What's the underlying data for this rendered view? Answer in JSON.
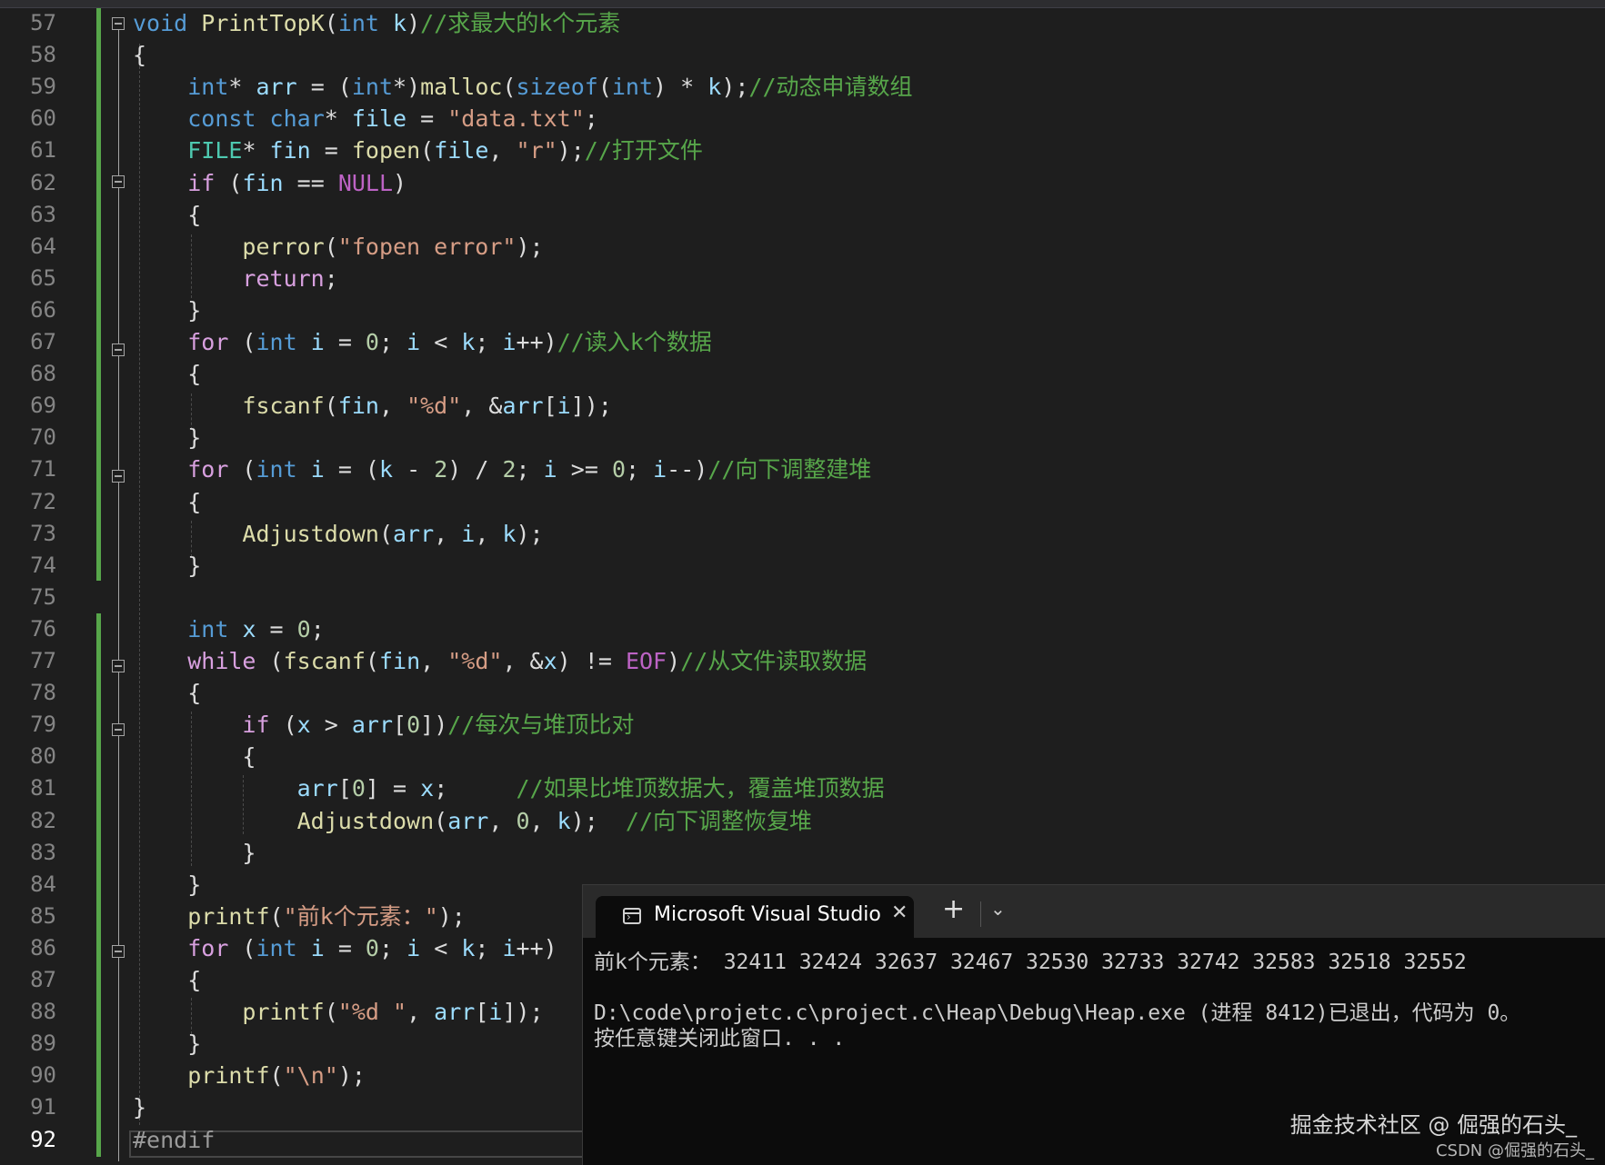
{
  "editor": {
    "current_line": "92",
    "lines": [
      {
        "n": "57",
        "t": [
          [
            "void",
            "kw"
          ],
          [
            " ",
            ""
          ],
          [
            "PrintTopK",
            "fn"
          ],
          [
            "(",
            ""
          ],
          [
            "int",
            "kw"
          ],
          [
            " ",
            ""
          ],
          [
            "k",
            "var"
          ],
          [
            ")",
            ""
          ],
          [
            "//求最大的k个元素",
            "cmt"
          ]
        ]
      },
      {
        "n": "58",
        "t": [
          [
            "{",
            ""
          ]
        ]
      },
      {
        "n": "59",
        "t": [
          [
            "    ",
            ""
          ],
          [
            "int",
            "kw"
          ],
          [
            "* ",
            ""
          ],
          [
            "arr",
            "var"
          ],
          [
            " = (",
            ""
          ],
          [
            "int",
            "kw"
          ],
          [
            "*)",
            ""
          ],
          [
            "malloc",
            "fn"
          ],
          [
            "(",
            ""
          ],
          [
            "sizeof",
            "kw"
          ],
          [
            "(",
            ""
          ],
          [
            "int",
            "kw"
          ],
          [
            ") * ",
            ""
          ],
          [
            "k",
            "var"
          ],
          [
            ");",
            ""
          ],
          [
            "//动态申请数组",
            "cmt"
          ]
        ]
      },
      {
        "n": "60",
        "t": [
          [
            "    ",
            ""
          ],
          [
            "const",
            "kw"
          ],
          [
            " ",
            ""
          ],
          [
            "char",
            "kw"
          ],
          [
            "* ",
            ""
          ],
          [
            "file",
            "var"
          ],
          [
            " = ",
            ""
          ],
          [
            "\"data.txt\"",
            "str"
          ],
          [
            ";",
            ""
          ]
        ]
      },
      {
        "n": "61",
        "t": [
          [
            "    ",
            ""
          ],
          [
            "FILE",
            "ty"
          ],
          [
            "* ",
            ""
          ],
          [
            "fin",
            "var"
          ],
          [
            " = ",
            ""
          ],
          [
            "fopen",
            "fn"
          ],
          [
            "(",
            ""
          ],
          [
            "file",
            "var"
          ],
          [
            ", ",
            ""
          ],
          [
            "\"r\"",
            "str"
          ],
          [
            ");",
            ""
          ],
          [
            "//打开文件",
            "cmt"
          ]
        ]
      },
      {
        "n": "62",
        "t": [
          [
            "    ",
            ""
          ],
          [
            "if",
            "ctl"
          ],
          [
            " (",
            ""
          ],
          [
            "fin",
            "var"
          ],
          [
            " == ",
            ""
          ],
          [
            "NULL",
            "mac"
          ],
          [
            ")",
            ""
          ]
        ]
      },
      {
        "n": "63",
        "t": [
          [
            "    {",
            ""
          ]
        ]
      },
      {
        "n": "64",
        "t": [
          [
            "        ",
            ""
          ],
          [
            "perror",
            "fn"
          ],
          [
            "(",
            ""
          ],
          [
            "\"fopen error\"",
            "str"
          ],
          [
            ");",
            ""
          ]
        ]
      },
      {
        "n": "65",
        "t": [
          [
            "        ",
            ""
          ],
          [
            "return",
            "ctl"
          ],
          [
            ";",
            ""
          ]
        ]
      },
      {
        "n": "66",
        "t": [
          [
            "    }",
            ""
          ]
        ]
      },
      {
        "n": "67",
        "t": [
          [
            "    ",
            ""
          ],
          [
            "for",
            "ctl"
          ],
          [
            " (",
            ""
          ],
          [
            "int",
            "kw"
          ],
          [
            " ",
            ""
          ],
          [
            "i",
            "var"
          ],
          [
            " = ",
            ""
          ],
          [
            "0",
            "num"
          ],
          [
            "; ",
            ""
          ],
          [
            "i",
            "var"
          ],
          [
            " < ",
            ""
          ],
          [
            "k",
            "var"
          ],
          [
            "; ",
            ""
          ],
          [
            "i",
            "var"
          ],
          [
            "++)",
            ""
          ],
          [
            "//读入k个数据",
            "cmt"
          ]
        ]
      },
      {
        "n": "68",
        "t": [
          [
            "    {",
            ""
          ]
        ]
      },
      {
        "n": "69",
        "t": [
          [
            "        ",
            ""
          ],
          [
            "fscanf",
            "fn"
          ],
          [
            "(",
            ""
          ],
          [
            "fin",
            "var"
          ],
          [
            ", ",
            ""
          ],
          [
            "\"%d\"",
            "str"
          ],
          [
            ", &",
            ""
          ],
          [
            "arr",
            "var"
          ],
          [
            "[",
            ""
          ],
          [
            "i",
            "var"
          ],
          [
            "]);",
            ""
          ]
        ]
      },
      {
        "n": "70",
        "t": [
          [
            "    }",
            ""
          ]
        ]
      },
      {
        "n": "71",
        "t": [
          [
            "    ",
            ""
          ],
          [
            "for",
            "ctl"
          ],
          [
            " (",
            ""
          ],
          [
            "int",
            "kw"
          ],
          [
            " ",
            ""
          ],
          [
            "i",
            "var"
          ],
          [
            " = (",
            ""
          ],
          [
            "k",
            "var"
          ],
          [
            " - ",
            ""
          ],
          [
            "2",
            "num"
          ],
          [
            ") / ",
            ""
          ],
          [
            "2",
            "num"
          ],
          [
            "; ",
            ""
          ],
          [
            "i",
            "var"
          ],
          [
            " >= ",
            ""
          ],
          [
            "0",
            "num"
          ],
          [
            "; ",
            ""
          ],
          [
            "i",
            "var"
          ],
          [
            "--)",
            ""
          ],
          [
            "//向下调整建堆",
            "cmt"
          ]
        ]
      },
      {
        "n": "72",
        "t": [
          [
            "    {",
            ""
          ]
        ]
      },
      {
        "n": "73",
        "t": [
          [
            "        ",
            ""
          ],
          [
            "Adjustdown",
            "fn"
          ],
          [
            "(",
            ""
          ],
          [
            "arr",
            "var"
          ],
          [
            ", ",
            ""
          ],
          [
            "i",
            "var"
          ],
          [
            ", ",
            ""
          ],
          [
            "k",
            "var"
          ],
          [
            ");",
            ""
          ]
        ]
      },
      {
        "n": "74",
        "t": [
          [
            "    }",
            ""
          ]
        ]
      },
      {
        "n": "75",
        "t": []
      },
      {
        "n": "76",
        "t": [
          [
            "    ",
            ""
          ],
          [
            "int",
            "kw"
          ],
          [
            " ",
            ""
          ],
          [
            "x",
            "var"
          ],
          [
            " = ",
            ""
          ],
          [
            "0",
            "num"
          ],
          [
            ";",
            ""
          ]
        ]
      },
      {
        "n": "77",
        "t": [
          [
            "    ",
            ""
          ],
          [
            "while",
            "ctl"
          ],
          [
            " (",
            ""
          ],
          [
            "fscanf",
            "fn"
          ],
          [
            "(",
            ""
          ],
          [
            "fin",
            "var"
          ],
          [
            ", ",
            ""
          ],
          [
            "\"%d\"",
            "str"
          ],
          [
            ", &",
            ""
          ],
          [
            "x",
            "var"
          ],
          [
            ") != ",
            ""
          ],
          [
            "EOF",
            "mac"
          ],
          [
            ")",
            ""
          ],
          [
            "//从文件读取数据",
            "cmt"
          ]
        ]
      },
      {
        "n": "78",
        "t": [
          [
            "    {",
            ""
          ]
        ]
      },
      {
        "n": "79",
        "t": [
          [
            "        ",
            ""
          ],
          [
            "if",
            "ctl"
          ],
          [
            " (",
            ""
          ],
          [
            "x",
            "var"
          ],
          [
            " > ",
            ""
          ],
          [
            "arr",
            "var"
          ],
          [
            "[",
            ""
          ],
          [
            "0",
            "num"
          ],
          [
            "])",
            ""
          ],
          [
            "//每次与堆顶比对",
            "cmt"
          ]
        ]
      },
      {
        "n": "80",
        "t": [
          [
            "        {",
            ""
          ]
        ]
      },
      {
        "n": "81",
        "t": [
          [
            "            ",
            ""
          ],
          [
            "arr",
            "var"
          ],
          [
            "[",
            ""
          ],
          [
            "0",
            "num"
          ],
          [
            "] = ",
            ""
          ],
          [
            "x",
            "var"
          ],
          [
            ";     ",
            ""
          ],
          [
            "//如果比堆顶数据大，覆盖堆顶数据",
            "cmt"
          ]
        ]
      },
      {
        "n": "82",
        "t": [
          [
            "            ",
            ""
          ],
          [
            "Adjustdown",
            "fn"
          ],
          [
            "(",
            ""
          ],
          [
            "arr",
            "var"
          ],
          [
            ", ",
            ""
          ],
          [
            "0",
            "num"
          ],
          [
            ", ",
            ""
          ],
          [
            "k",
            "var"
          ],
          [
            ");  ",
            ""
          ],
          [
            "//向下调整恢复堆",
            "cmt"
          ]
        ]
      },
      {
        "n": "83",
        "t": [
          [
            "        }",
            ""
          ]
        ]
      },
      {
        "n": "84",
        "t": [
          [
            "    }",
            ""
          ]
        ]
      },
      {
        "n": "85",
        "t": [
          [
            "    ",
            ""
          ],
          [
            "printf",
            "fn"
          ],
          [
            "(",
            ""
          ],
          [
            "\"前k个元素：\"",
            "str"
          ],
          [
            ");",
            ""
          ]
        ]
      },
      {
        "n": "86",
        "t": [
          [
            "    ",
            ""
          ],
          [
            "for",
            "ctl"
          ],
          [
            " (",
            ""
          ],
          [
            "int",
            "kw"
          ],
          [
            " ",
            ""
          ],
          [
            "i",
            "var"
          ],
          [
            " = ",
            ""
          ],
          [
            "0",
            "num"
          ],
          [
            "; ",
            ""
          ],
          [
            "i",
            "var"
          ],
          [
            " < ",
            ""
          ],
          [
            "k",
            "var"
          ],
          [
            "; ",
            ""
          ],
          [
            "i",
            "var"
          ],
          [
            "++)",
            ""
          ]
        ]
      },
      {
        "n": "87",
        "t": [
          [
            "    {",
            ""
          ]
        ]
      },
      {
        "n": "88",
        "t": [
          [
            "        ",
            ""
          ],
          [
            "printf",
            "fn"
          ],
          [
            "(",
            ""
          ],
          [
            "\"%d \"",
            "str"
          ],
          [
            ", ",
            ""
          ],
          [
            "arr",
            "var"
          ],
          [
            "[",
            ""
          ],
          [
            "i",
            "var"
          ],
          [
            "]);",
            ""
          ]
        ]
      },
      {
        "n": "89",
        "t": [
          [
            "    }",
            ""
          ]
        ]
      },
      {
        "n": "90",
        "t": [
          [
            "    ",
            ""
          ],
          [
            "printf",
            "fn"
          ],
          [
            "(",
            ""
          ],
          [
            "\"\\n\"",
            "str"
          ],
          [
            ");",
            ""
          ]
        ]
      },
      {
        "n": "91",
        "t": [
          [
            "}",
            ""
          ]
        ]
      },
      {
        "n": "92",
        "t": [
          [
            "#endif",
            "pp"
          ]
        ]
      }
    ]
  },
  "console": {
    "tab_title": "Microsoft Visual Studio",
    "close_glyph": "✕",
    "add_glyph": "+",
    "dropdown_glyph": "⌄",
    "output": [
      "前k个元素： 32411 32424 32637 32467 32530 32733 32742 32583 32518 32552",
      "",
      "D:\\code\\projetc.c\\project.c\\Heap\\Debug\\Heap.exe (进程 8412)已退出，代码为 0。",
      "按任意键关闭此窗口. . ."
    ]
  },
  "watermark": {
    "primary": "掘金技术社区 @ 倔强的石头_",
    "secondary": "CSDN @倔强的石头_"
  }
}
